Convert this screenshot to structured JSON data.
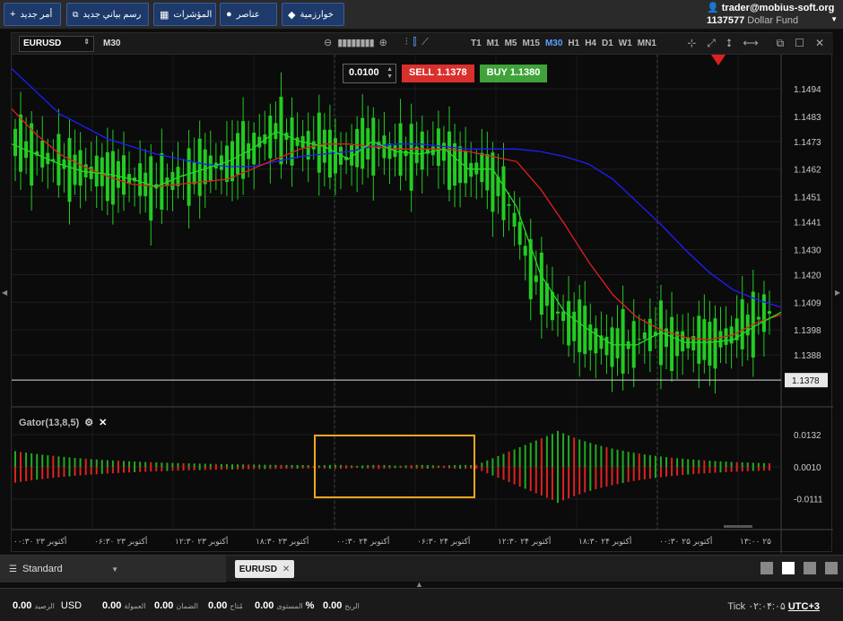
{
  "toolbar": {
    "buttons": [
      {
        "label": "أمر جديد",
        "icon": "+"
      },
      {
        "label": "رسم بياني جديد",
        "icon": "📈"
      },
      {
        "label": "المؤشرات",
        "icon": "▦"
      },
      {
        "label": "عناصر",
        "icon": "●"
      },
      {
        "label": "خوارزمية",
        "icon": "◆"
      }
    ],
    "account_email": "trader@mobius-soft.org",
    "account_id": "1137577",
    "account_type": "Dollar Fund"
  },
  "chart_toolbar": {
    "symbol": "EURUSD",
    "timeframe": "M30",
    "timeframes": [
      "T1",
      "M1",
      "M5",
      "M15",
      "M30",
      "H1",
      "H4",
      "D1",
      "W1",
      "MN1"
    ],
    "active_timeframe": "M30"
  },
  "trade_panel": {
    "lot": "0.0100",
    "sell_label": "SELL",
    "sell_price": "1.1378",
    "buy_label": "BUY",
    "buy_price": "1.1380"
  },
  "chart_data": {
    "type": "line",
    "symbol": "EURUSD",
    "y_ticks": [
      "1.1494",
      "1.1483",
      "1.1473",
      "1.1462",
      "1.1451",
      "1.1441",
      "1.1430",
      "1.1420",
      "1.1409",
      "1.1398",
      "1.1388"
    ],
    "current_price": "1.1378",
    "ylim": [
      1.1372,
      1.1504
    ],
    "indicator": {
      "name": "Gator(13,8,5)",
      "y_ticks": [
        "0.0132",
        "0.0010",
        "-0.0111"
      ]
    },
    "x_ticks": [
      "۰۰:۳۰ ۲۳ أكتوبر",
      "۰۶:۳۰ ۲۳ أكتوبر",
      "۱۲:۳۰ ۲۳ أكتوبر",
      "۱۸:۳۰ ۲۳ أكتوبر",
      "۰۰:۳۰ ۲۴ أكتوبر",
      "۰۶:۳۰ ۲۴ أكتوبر",
      "۱۲:۳۰ ۲۴ أكتوبر",
      "۱۸:۳۰ ۲۴ أكتوبر",
      "۰۰:۳۰ ۲۵ أكتوبر",
      "۱۳:۰۰ ۲۵"
    ],
    "series": [
      {
        "color": "#1e1eff",
        "values": [
          1.1502,
          1.1493,
          1.1484,
          1.1479,
          1.1474,
          1.1471,
          1.1468,
          1.1466,
          1.1464,
          1.1463,
          1.1463,
          1.1465,
          1.1467,
          1.1468,
          1.1469,
          1.1471,
          1.1472,
          1.1472,
          1.1471,
          1.147,
          1.147,
          1.147,
          1.1469,
          1.1467,
          1.1464,
          1.1458,
          1.1449,
          1.144,
          1.143,
          1.1421,
          1.1414,
          1.141,
          1.1407
        ]
      },
      {
        "color": "#e02020",
        "values": [
          1.1486,
          1.1476,
          1.1468,
          1.1463,
          1.1459,
          1.1456,
          1.1455,
          1.1456,
          1.1457,
          1.1458,
          1.1462,
          1.1466,
          1.147,
          1.1472,
          1.1472,
          1.1471,
          1.147,
          1.147,
          1.147,
          1.1469,
          1.1467,
          1.1465,
          1.1454,
          1.144,
          1.1425,
          1.1412,
          1.1403,
          1.1398,
          1.1395,
          1.1394,
          1.1396,
          1.1401,
          1.1404
        ]
      },
      {
        "color": "#22dd22",
        "values": [
          1.1472,
          1.1468,
          1.1464,
          1.1461,
          1.146,
          1.1458,
          1.1455,
          1.1459,
          1.1462,
          1.1465,
          1.147,
          1.1477,
          1.1473,
          1.1471,
          1.1466,
          1.1473,
          1.1469,
          1.1468,
          1.147,
          1.1462,
          1.1462,
          1.1447,
          1.142,
          1.1405,
          1.1398,
          1.1392,
          1.1392,
          1.1397,
          1.1393,
          1.1393,
          1.1394,
          1.14,
          1.1405
        ]
      }
    ]
  },
  "tabs": {
    "template": "Standard",
    "symbol_tab": "EURUSD"
  },
  "status": {
    "balance_label": "الرصيد",
    "balance": "0.00",
    "currency": "USD",
    "commission_label": "العمولة",
    "commission": "0.00",
    "margin_label": "الضمان",
    "margin": "0.00",
    "free_label": "مُتاح",
    "free": "0.00",
    "level_label": "المستوى",
    "level": "0.00",
    "level_unit": "%",
    "profit_label": "الربح",
    "profit": "0.00",
    "tick_label": "Tick",
    "tick_time": "۰۲:۰۴:۰۵",
    "tz": "UTC+3"
  }
}
